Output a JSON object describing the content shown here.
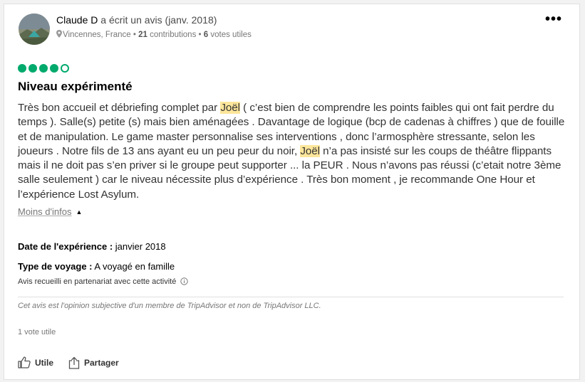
{
  "author": {
    "name": "Claude D",
    "action_text": "a écrit un avis (janv. 2018)",
    "location": "Vincennes, France",
    "contributions_count": "21",
    "contributions_label": "contributions",
    "votes_count": "6",
    "votes_label": "votes utiles"
  },
  "menu_icon": "more-options-icon",
  "rating": {
    "value": 4,
    "max": 5,
    "color": "#00aa6c"
  },
  "review": {
    "title": "Niveau expérimenté",
    "text_parts": [
      {
        "text": "Très bon accueil et débriefing complet par ",
        "highlight": false
      },
      {
        "text": "Joël",
        "highlight": true
      },
      {
        "text": " ( c’est bien de comprendre les points faibles qui ont fait perdre du temps ). Salle(s) petite (s) mais bien aménagées . Davantage de logique (bcp de cadenas à chiffres ) que de fouille et de manipulation. Le game master personnalise ses interventions , donc l’armosphère stressante, selon les joueurs . Notre fils de 13 ans ayant eu un peu peur du noir, ",
        "highlight": false
      },
      {
        "text": "Joël",
        "highlight": true
      },
      {
        "text": " n’a pas insisté sur les coups de théâtre flippants mais il ne doit pas s’en priver si le groupe peut supporter ... la PEUR . Nous n’avons pas réussi (c’etait notre 3ème salle seulement ) car le niveau nécessite plus d’expérience . Très bon moment , je recommande One Hour et l’expérience Lost Asylum.",
        "highlight": false
      }
    ],
    "highlight_color": "#fde69b",
    "less_info": "Moins d'infos"
  },
  "details": {
    "date_label": "Date de l'expérience :",
    "date_value": "janvier 2018",
    "trip_label": "Type de voyage :",
    "trip_value": "A voyagé en famille",
    "partnership": "Avis recueilli en partenariat avec cette activité"
  },
  "disclaimer": "Cet avis est l'opinion subjective d'un membre de TripAdvisor et non de TripAdvisor LLC.",
  "helpful_votes": "1 vote utile",
  "actions": {
    "helpful": "Utile",
    "share": "Partager"
  }
}
